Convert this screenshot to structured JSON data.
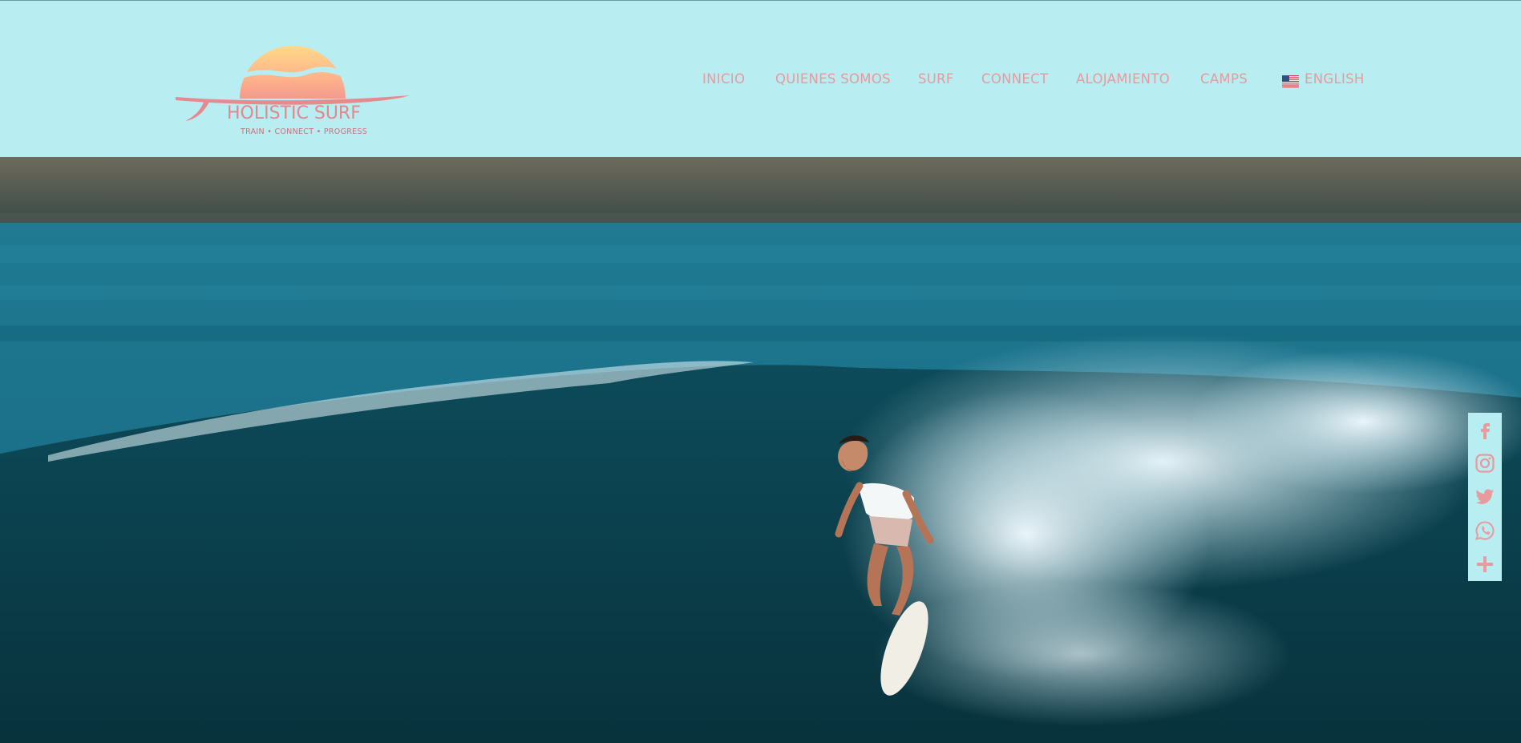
{
  "brand": {
    "name": "HOLISTIC SURF",
    "tagline": "TRAIN • CONNECT • PROGRESS"
  },
  "nav": {
    "items": [
      "INICIO",
      "QUIENES SOMOS",
      "SURF",
      "CONNECT",
      "ALOJAMIENTO",
      "CAMPS"
    ],
    "language": "ENGLISH"
  },
  "share": {
    "icons": [
      "facebook-icon",
      "instagram-icon",
      "twitter-icon",
      "whatsapp-icon",
      "more-icon"
    ]
  },
  "colors": {
    "header_bg": "#b8edf2",
    "nav_text": "#e89a9d",
    "logo_coral": "#e3878c"
  }
}
